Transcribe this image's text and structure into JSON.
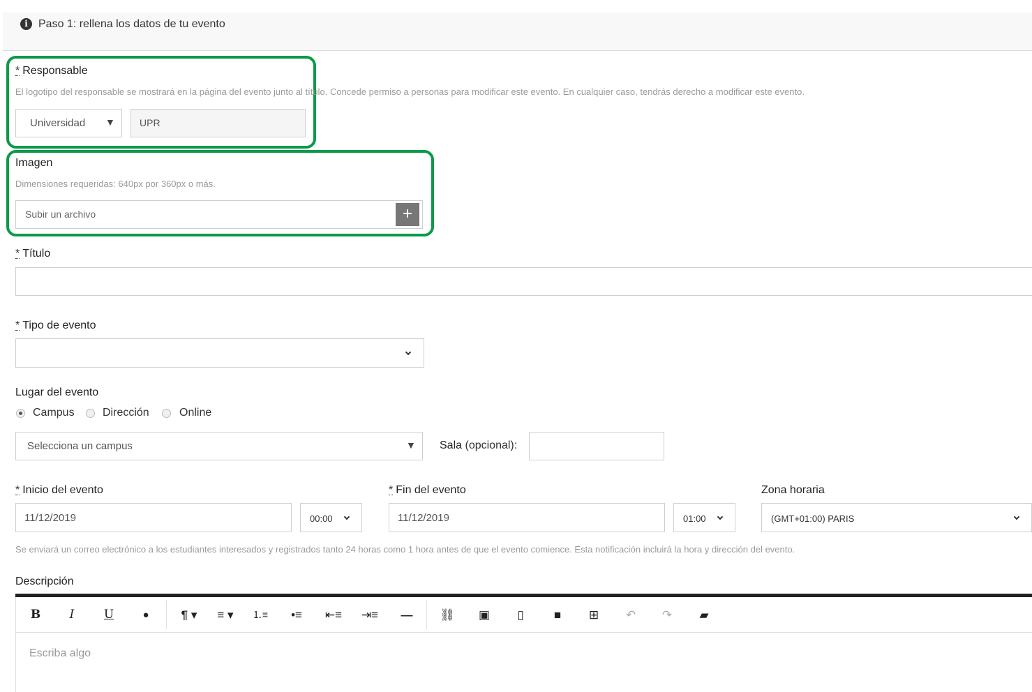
{
  "header": {
    "title": "Paso 1: rellena los datos de tu evento"
  },
  "required_mark": "*",
  "responsable": {
    "label": "Responsable",
    "help": "El logotipo del responsable se mostrará en la página del evento junto al título. Concede permiso a personas para modificar este evento. En cualquier caso, tendrás derecho a modificar este evento.",
    "type_value": "Universidad",
    "name_value": "UPR"
  },
  "imagen": {
    "label": "Imagen",
    "help": "Dimensiones requeridas: 640px por 360px o más.",
    "upload_placeholder": "Subir un archivo",
    "add_symbol": "+"
  },
  "titulo": {
    "label": "Título",
    "value": ""
  },
  "tipo_evento": {
    "label": "Tipo de evento",
    "value": ""
  },
  "lugar": {
    "label": "Lugar del evento",
    "options": [
      "Campus",
      "Dirección",
      "Online"
    ],
    "selected": "Campus",
    "campus_placeholder": "Selecciona un campus",
    "sala_label": "Sala",
    "sala_optional": "(opcional):",
    "sala_value": ""
  },
  "inicio": {
    "label": "Inicio del evento",
    "date": "11/12/2019",
    "time": "00:00"
  },
  "fin": {
    "label": "Fin del evento",
    "date": "11/12/2019",
    "time": "01:00"
  },
  "zona": {
    "label": "Zona horaria",
    "value": "(GMT+01:00) PARIS"
  },
  "notice": "Se enviará un correo electrónico a los estudiantes interesados y registrados tanto 24 horas como 1 hora antes de que el evento comience. Esta notificación incluirá la hora y dirección del evento.",
  "descripcion": {
    "label": "Descripción",
    "placeholder": "Escriba algo",
    "toolbar": [
      "bold-icon",
      "italic-icon",
      "underline-icon",
      "text-color-icon",
      "paragraph-icon",
      "align-icon",
      "ordered-list-icon",
      "unordered-list-icon",
      "outdent-icon",
      "indent-icon",
      "horizontal-rule-icon",
      "link-icon",
      "image-icon",
      "file-icon",
      "video-icon",
      "table-icon",
      "undo-icon",
      "redo-icon",
      "clear-format-icon"
    ]
  },
  "colors": {
    "highlight": "#0a9a48",
    "toolbar_bar": "#222222",
    "help_text": "#9a9a9a"
  }
}
